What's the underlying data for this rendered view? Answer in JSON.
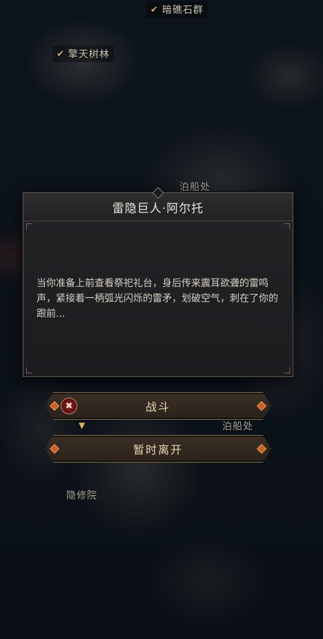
{
  "map": {
    "labels": {
      "reef": "暗礁石群",
      "forest": "擎天树林",
      "dock_top": "泊船处",
      "dock_right": "泊船处",
      "hermitage": "隐修院"
    }
  },
  "dialog": {
    "title": "雷隐巨人·阿尔托",
    "body": "当你准备上前查看祭祀礼台，身后传来震耳欲聋的雷鸣声，紧接着一柄弧光闪烁的雷矛，划破空气，刺在了你的跟前..."
  },
  "actions": {
    "fight_label": "战斗",
    "leave_label": "暂时离开"
  }
}
